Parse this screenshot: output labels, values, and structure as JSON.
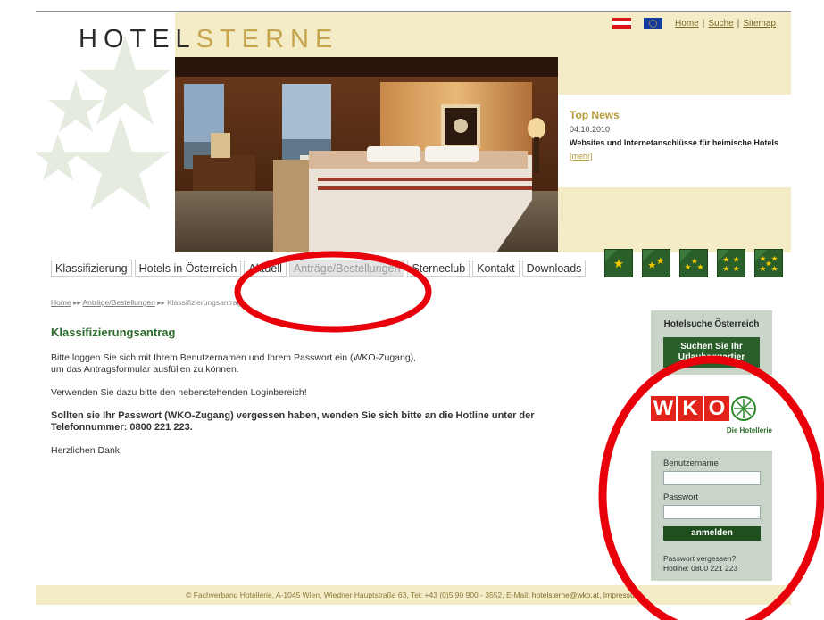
{
  "logo": {
    "part1": "HOTEL",
    "part2": "STERNE"
  },
  "toplinks": {
    "home": "Home",
    "sep1": "|",
    "search": "Suche",
    "sep2": "|",
    "sitemap": "Sitemap"
  },
  "news": {
    "title": "Top News",
    "date": "04.10.2010",
    "text": "Websites und Internetanschlüsse für heimische Hotels",
    "more": "[mehr]"
  },
  "nav": {
    "items": [
      "Klassifizierung",
      "Hotels in Österreich",
      "Aktuell",
      "Anträge/Bestellungen",
      "Sterneclub",
      "Kontakt",
      "Downloads"
    ],
    "active_index": 3
  },
  "breadcrumb": {
    "home": "Home",
    "section": "Anträge/Bestellungen",
    "current": "Klassifizierungsantrag"
  },
  "content": {
    "title": "Klassifizierungsantrag",
    "p1a": "Bitte loggen Sie sich mit Ihrem Benutzernamen und Ihrem Passwort ein (WKO-Zugang),",
    "p1b": "um das Antragsformular ausfüllen zu können.",
    "p2": "Verwenden Sie dazu bitte den nebenstehenden Loginbereich!",
    "p3": "Sollten sie Ihr Passwort (WKO-Zugang) vergessen haben, wenden Sie sich bitte an die Hotline unter der Telefonnummer: 0800 221 223.",
    "p4": "Herzlichen Dank!"
  },
  "sidebar": {
    "search_title": "Hotelsuche Österreich",
    "search_button": "Suchen Sie Ihr Urlaubsquartier"
  },
  "wko": {
    "letters": [
      "W",
      "K",
      "O"
    ],
    "subtitle": "Die Hotellerie"
  },
  "login": {
    "username_label": "Benutzername",
    "password_label": "Passwort",
    "button": "anmelden",
    "forgot": "Passwort vergessen?",
    "hotline": "Hotline: 0800 221 223"
  },
  "footer": {
    "text": "© Fachverband Hotellerie, A-1045 Wien, Wiedner Hauptstraße 63, Tel: +43 (0)5 90 900 - 3552, E-Mail: ",
    "email": "hotelsterne@wko.at",
    "sep": ", ",
    "imprint": "Impressum"
  },
  "colors": {
    "green": "#2a5e2a",
    "gold": "#c7a54c",
    "cream": "#f3ecc7",
    "red": "#e2231a",
    "annotation": "#e8000a"
  },
  "starboxes": [
    1,
    2,
    3,
    4,
    5
  ]
}
